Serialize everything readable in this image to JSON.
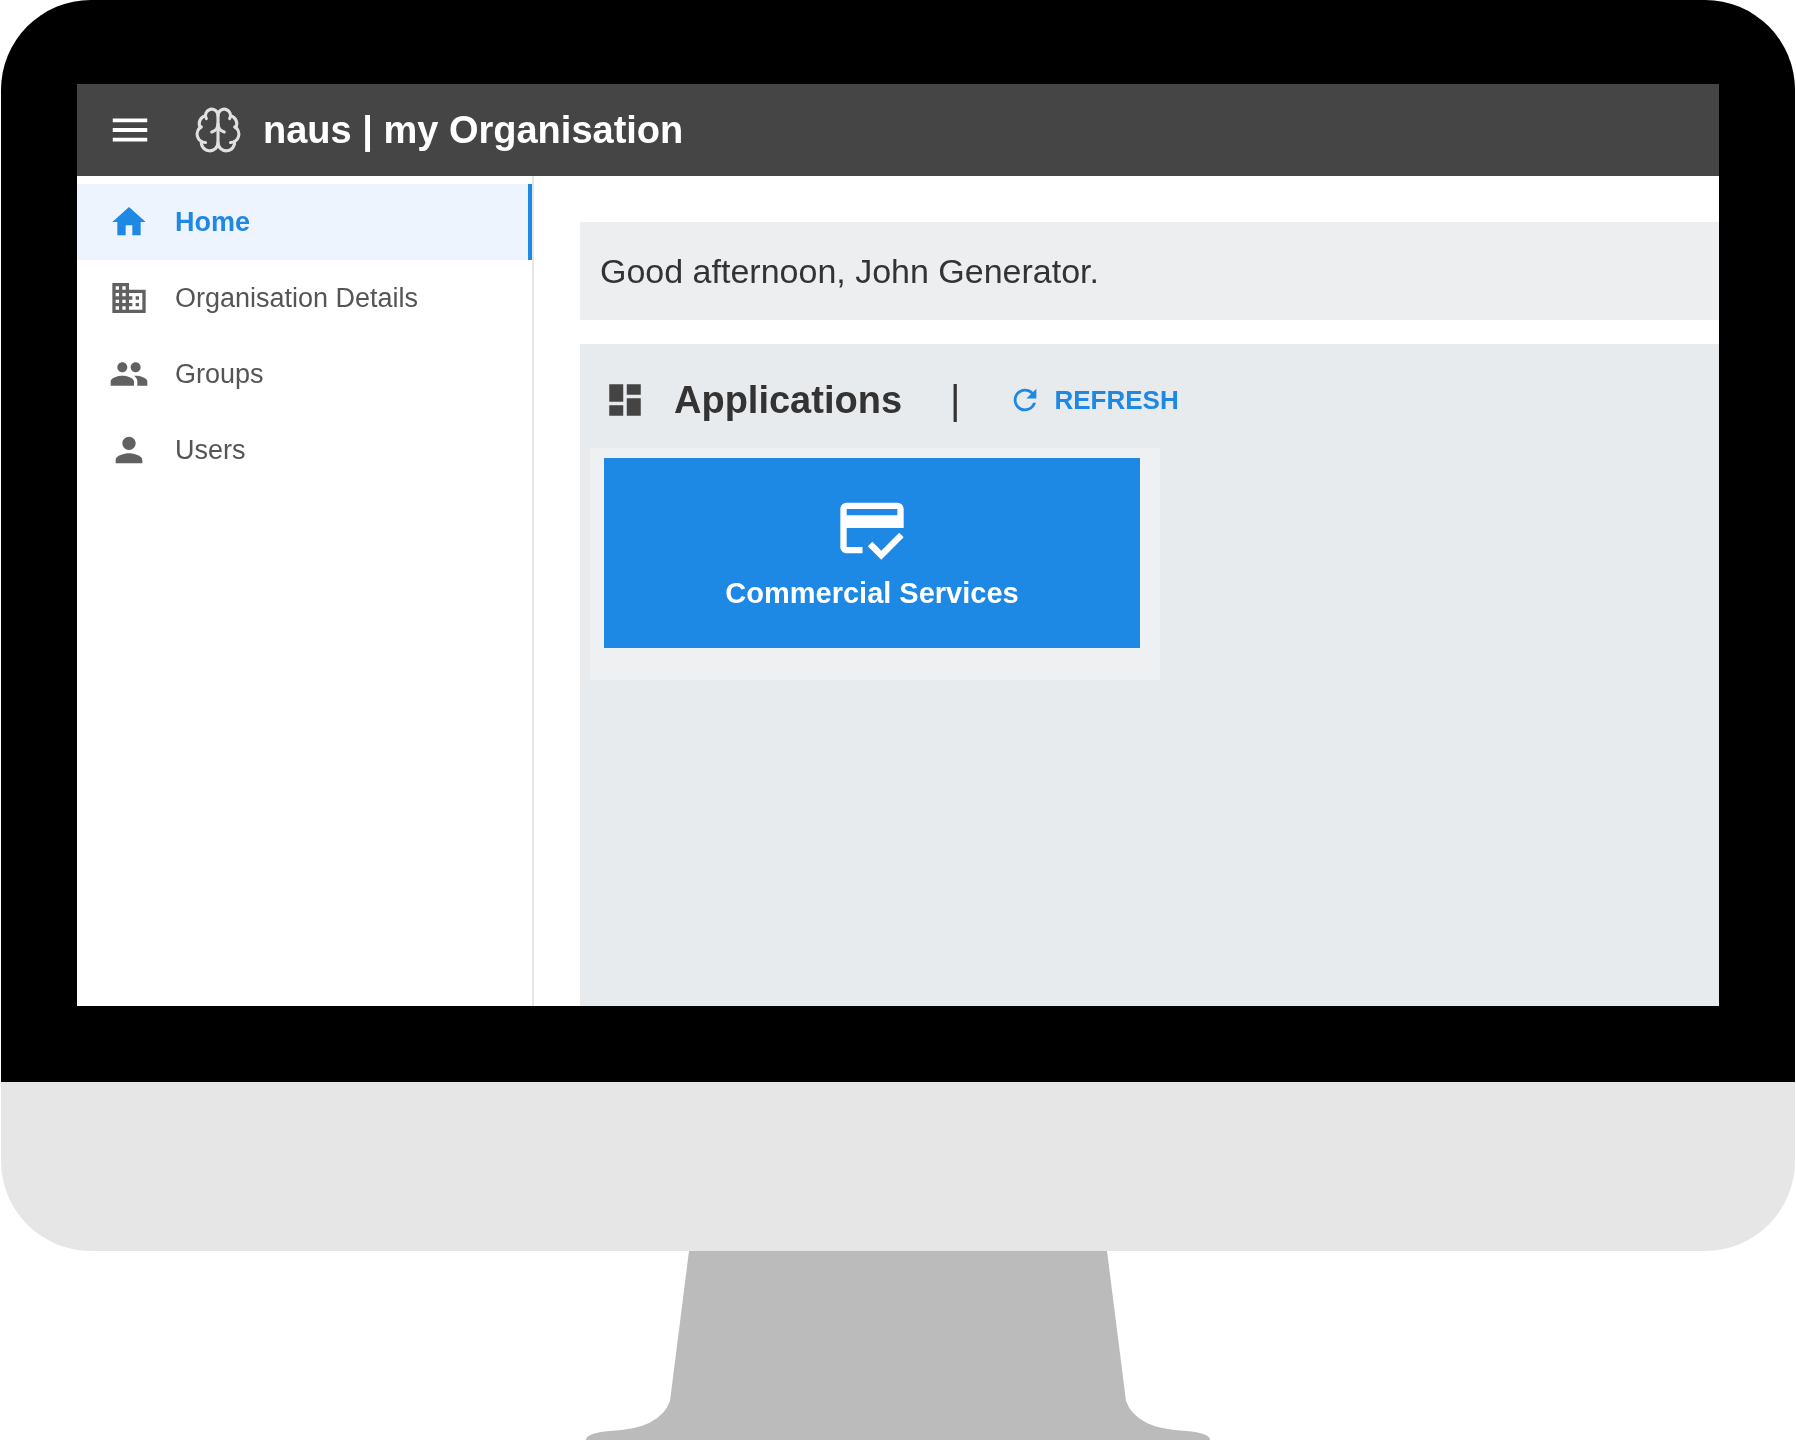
{
  "app_bar": {
    "title": "naus | my Organisation"
  },
  "sidebar": {
    "items": [
      {
        "label": "Home",
        "selected": true,
        "kind": "home"
      },
      {
        "label": "Organisation Details",
        "selected": false,
        "kind": "organisation"
      },
      {
        "label": "Groups",
        "selected": false,
        "kind": "groups"
      },
      {
        "label": "Users",
        "selected": false,
        "kind": "users"
      }
    ]
  },
  "greeting": "Good afternoon, John Generator.",
  "applications": {
    "title": "Applications",
    "separator": "|",
    "refresh": "REFRESH",
    "tiles": [
      {
        "label": "Commercial Services"
      }
    ]
  }
}
